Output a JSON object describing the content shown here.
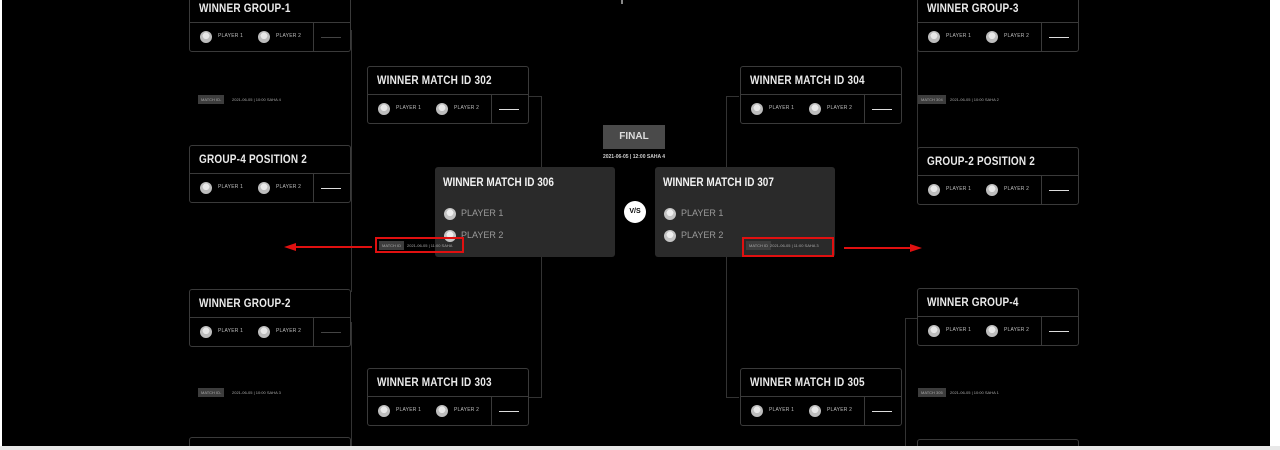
{
  "cards": {
    "winner_group_1": {
      "title": "WINNER GROUP-1",
      "p1": "PLAYER 1",
      "p2": "PLAYER 2"
    },
    "group4_position2": {
      "title": "GROUP-4 POSITION 2",
      "p1": "PLAYER 1",
      "p2": "PLAYER 2"
    },
    "winner_group_2": {
      "title": "WINNER GROUP-2",
      "p1": "PLAYER 1",
      "p2": "PLAYER 2"
    },
    "winner_match_302": {
      "title": "WINNER MATCH ID 302",
      "p1": "PLAYER 1",
      "p2": "PLAYER 2"
    },
    "winner_match_303": {
      "title": "WINNER MATCH ID 303",
      "p1": "PLAYER 1",
      "p2": "PLAYER 2"
    },
    "winner_match_304": {
      "title": "WINNER MATCH ID 304",
      "p1": "PLAYER 1",
      "p2": "PLAYER 2"
    },
    "winner_match_305": {
      "title": "WINNER MATCH ID 305",
      "p1": "PLAYER 1",
      "p2": "PLAYER 2"
    },
    "winner_group_3": {
      "title": "WINNER GROUP-3",
      "p1": "PLAYER 1",
      "p2": "PLAYER 2"
    },
    "group2_position2": {
      "title": "GROUP-2 POSITION 2",
      "p1": "PLAYER 1",
      "p2": "PLAYER 2"
    },
    "winner_group_4": {
      "title": "WINNER GROUP-4",
      "p1": "PLAYER 1",
      "p2": "PLAYER 2"
    }
  },
  "semis": {
    "left": {
      "title": "WINNER MATCH ID 306",
      "p1": "PLAYER 1",
      "p2": "PLAYER 2"
    },
    "right": {
      "title": "WINNER MATCH ID 307",
      "p1": "PLAYER 1",
      "p2": "PLAYER 2"
    }
  },
  "final": {
    "label": "FINAL",
    "date": "2021-06-05 | 12:00 SAHA 4",
    "vs": "V/S"
  },
  "infos": {
    "left_top": {
      "tag": "MATCH ID-",
      "when": "2021-06-05 | 10:00 SAHA 4"
    },
    "left_bottom": {
      "tag": "MATCH ID-",
      "when": "2021-06-05 | 10:00 SAHA 3"
    },
    "left_mid": {
      "tag": "MATCH ID",
      "when": "2021-06-05 | 11:00 SAHA"
    },
    "right_top": {
      "tag": "MATCH 304",
      "when": "2021-06-05 | 10:00 SAHA 2"
    },
    "right_bottom": {
      "tag": "MATCH 305",
      "when": "2021-06-05 | 10:00 SAHA 1"
    },
    "right_mid": {
      "tag": "MATCH ID",
      "when": "2021-06-05 | 11:00 SAHA 3"
    }
  },
  "colors": {
    "background": "#000000",
    "card_border": "#3a3a3a",
    "semi_card": "#2a2a2a",
    "highlight": "#e01010"
  }
}
